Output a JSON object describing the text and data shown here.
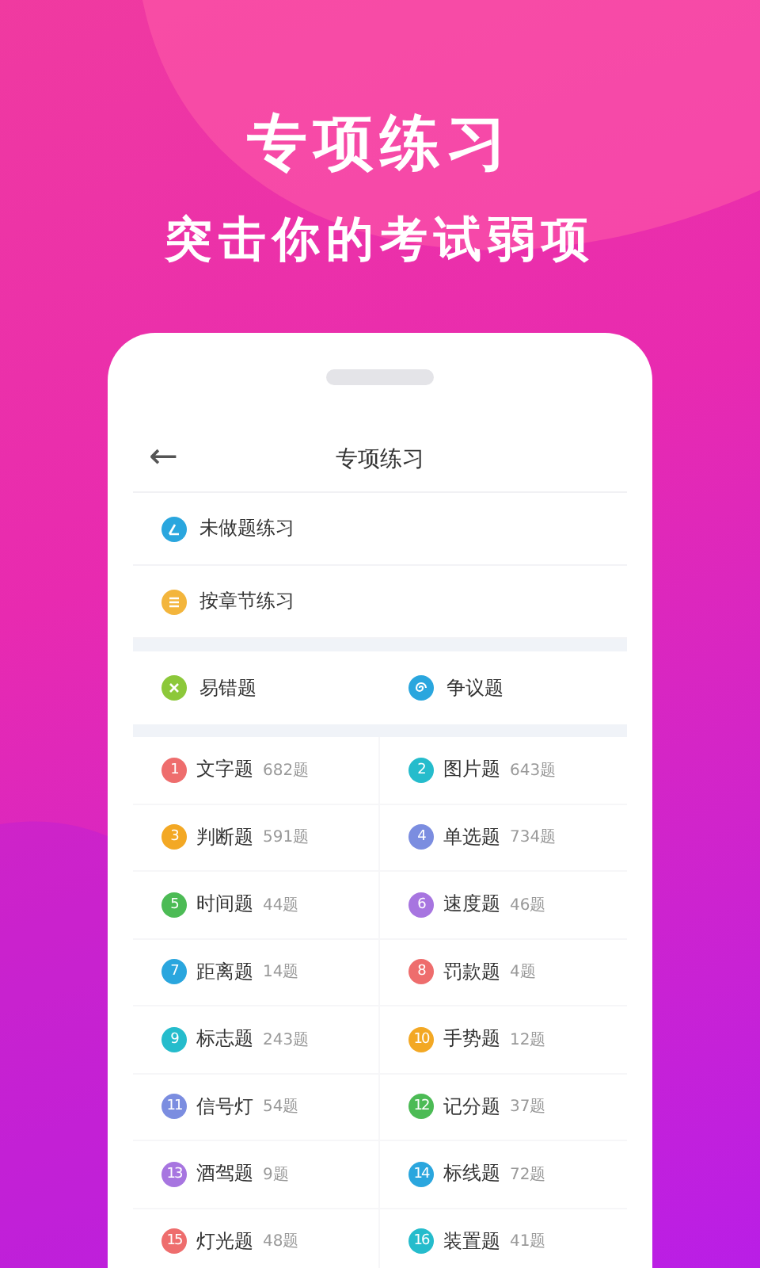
{
  "hero": {
    "title": "专项练习",
    "subtitle": "突击你的考试弱项"
  },
  "screen": {
    "back": "←",
    "title": "专项练习"
  },
  "practice_list": [
    {
      "label": "未做题练习",
      "color": "#2aa6de"
    },
    {
      "label": "按章节练习",
      "color": "#f3b53c"
    }
  ],
  "special": [
    {
      "label": "易错题",
      "color": "#8cc83a"
    },
    {
      "label": "争议题",
      "color": "#2aa6de"
    }
  ],
  "categories": [
    {
      "num": "1",
      "label": "文字题",
      "count": "682题",
      "color": "#ee6d6d"
    },
    {
      "num": "2",
      "label": "图片题",
      "count": "643题",
      "color": "#25bccc"
    },
    {
      "num": "3",
      "label": "判断题",
      "count": "591题",
      "color": "#f3a824"
    },
    {
      "num": "4",
      "label": "单选题",
      "count": "734题",
      "color": "#7b8de0"
    },
    {
      "num": "5",
      "label": "时间题",
      "count": "44题",
      "color": "#4cbb55"
    },
    {
      "num": "6",
      "label": "速度题",
      "count": "46题",
      "color": "#a775e0"
    },
    {
      "num": "7",
      "label": "距离题",
      "count": "14题",
      "color": "#2aa6de"
    },
    {
      "num": "8",
      "label": "罚款题",
      "count": "4题",
      "color": "#ee6d6d"
    },
    {
      "num": "9",
      "label": "标志题",
      "count": "243题",
      "color": "#25bccc"
    },
    {
      "num": "10",
      "label": "手势题",
      "count": "12题",
      "color": "#f3a824"
    },
    {
      "num": "11",
      "label": "信号灯",
      "count": "54题",
      "color": "#7b8de0"
    },
    {
      "num": "12",
      "label": "记分题",
      "count": "37题",
      "color": "#4cbb55"
    },
    {
      "num": "13",
      "label": "酒驾题",
      "count": "9题",
      "color": "#a775e0"
    },
    {
      "num": "14",
      "label": "标线题",
      "count": "72题",
      "color": "#2aa6de"
    },
    {
      "num": "15",
      "label": "灯光题",
      "count": "48题",
      "color": "#ee6d6d"
    },
    {
      "num": "16",
      "label": "装置题",
      "count": "41题",
      "color": "#25bccc"
    }
  ]
}
